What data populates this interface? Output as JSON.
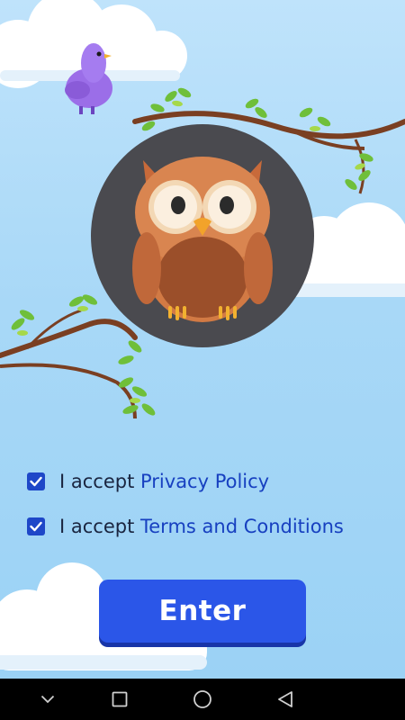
{
  "consents": [
    {
      "prefix": "I accept ",
      "link": "Privacy Policy",
      "checked": true
    },
    {
      "prefix": "I accept ",
      "link": "Terms and Conditions",
      "checked": true
    }
  ],
  "enter_label": "Enter",
  "avatar_icon": "owl-icon",
  "navbar": {
    "icons": [
      "chevron-down-icon",
      "recents-square-icon",
      "home-circle-icon",
      "back-triangle-icon"
    ]
  },
  "colors": {
    "accent": "#2b56e8",
    "link": "#1740c0",
    "sky": "#a8d8f7"
  }
}
